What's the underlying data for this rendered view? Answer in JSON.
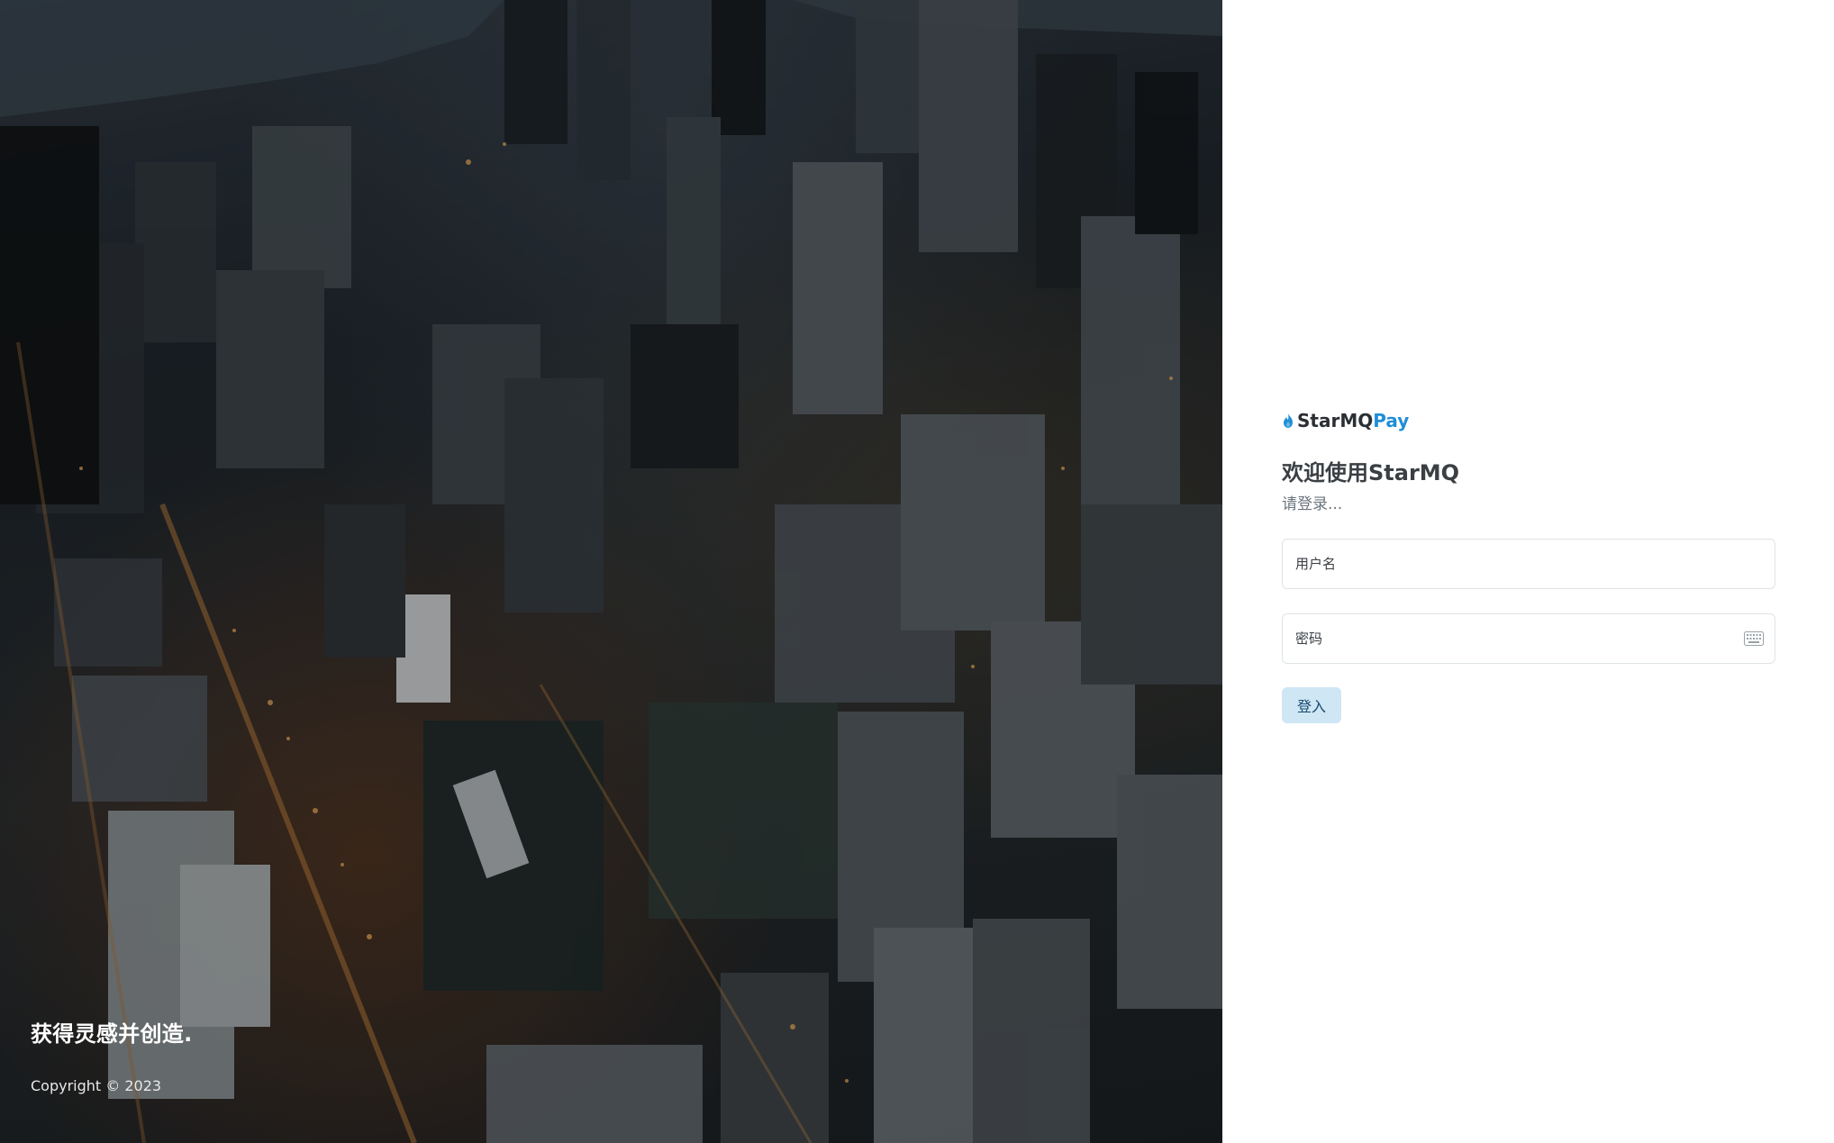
{
  "hero": {
    "tagline": "获得灵感并创造.",
    "copyright": "Copyright © 2023",
    "background": "aerial-city-night-image"
  },
  "brand": {
    "name_main": "StarMQ",
    "name_accent": "Pay",
    "logo_icon": "flame-icon",
    "accent_color": "#1f8fd6"
  },
  "login": {
    "title": "欢迎使用StarMQ",
    "subtitle": "请登录...",
    "username": {
      "placeholder": "用户名",
      "value": ""
    },
    "password": {
      "placeholder": "密码",
      "value": "",
      "icon": "keyboard-icon"
    },
    "submit_label": "登入",
    "submit_color": "#cfe6f5"
  }
}
